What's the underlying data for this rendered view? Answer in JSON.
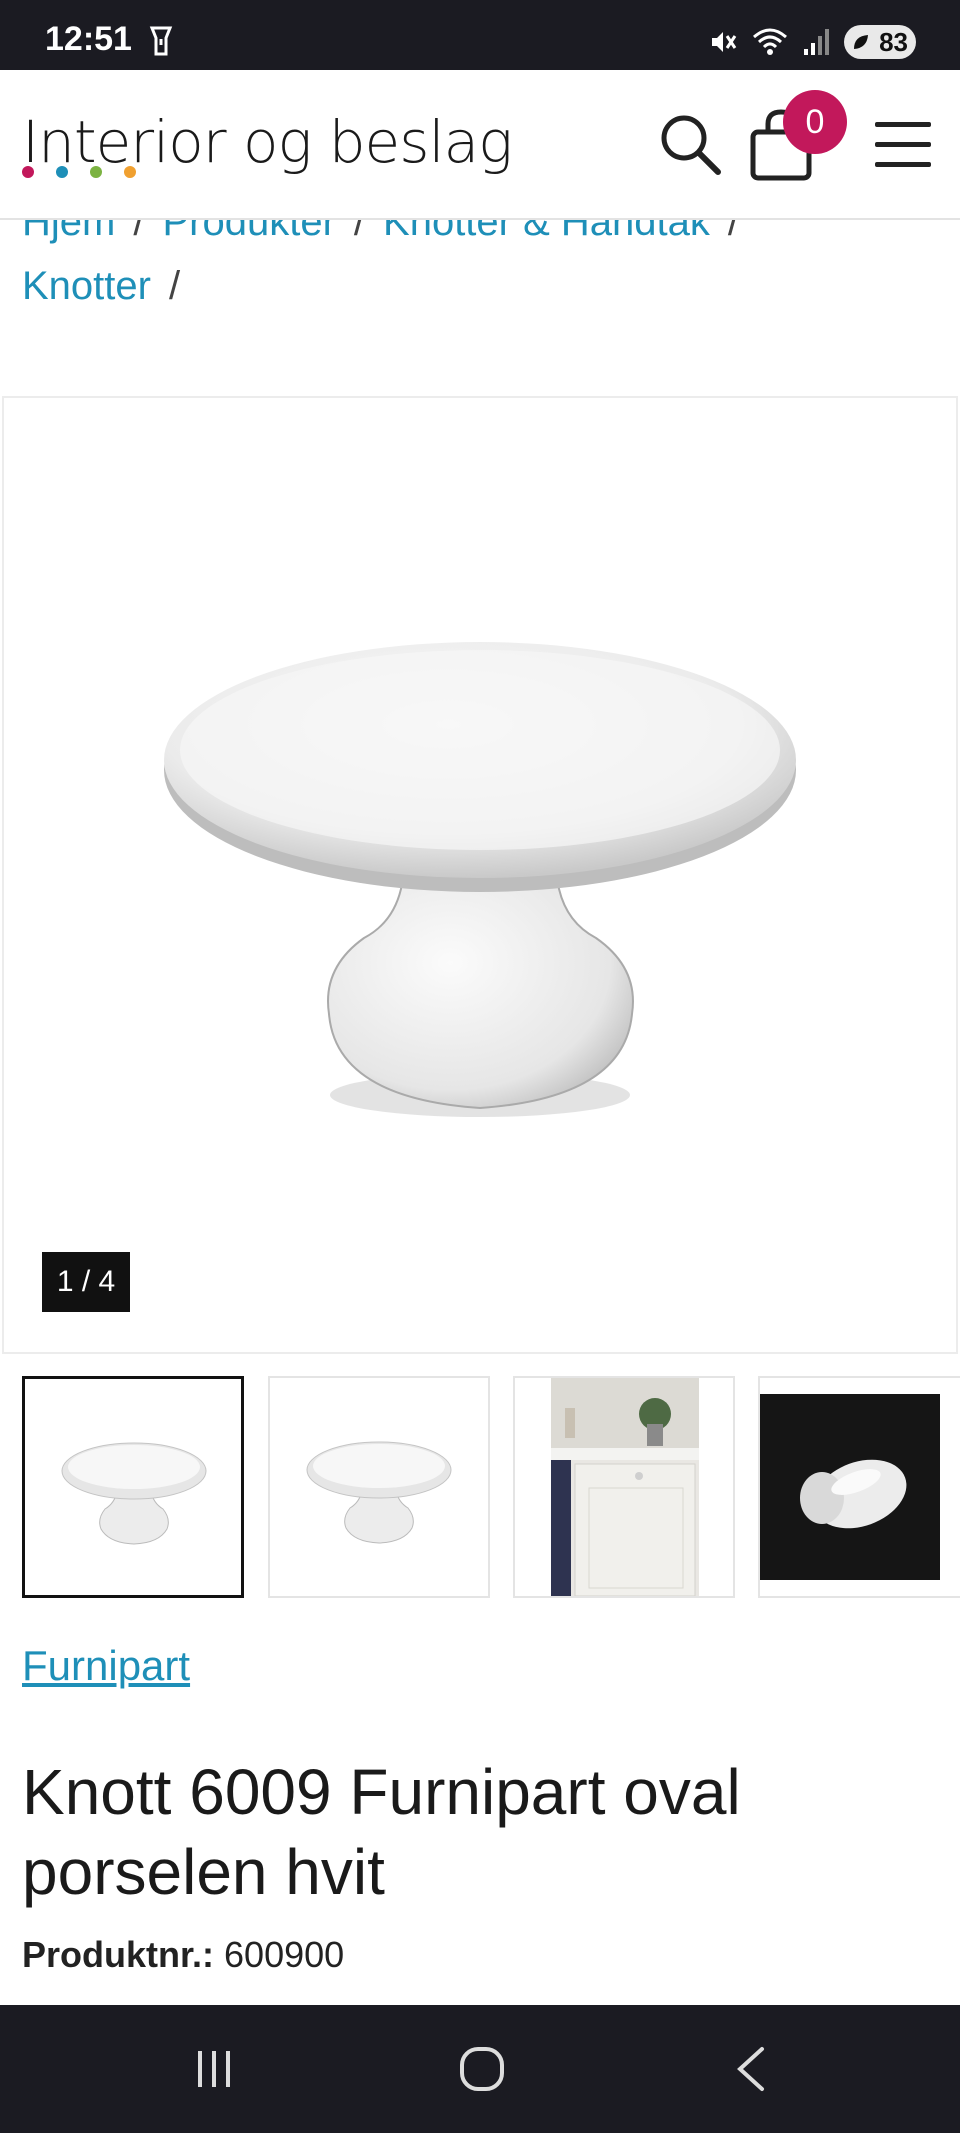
{
  "status_bar": {
    "time": "12:51",
    "battery": "83",
    "icons": [
      "flashlight-icon",
      "mute-icon",
      "wifi-icon",
      "signal-icon",
      "battery-icon"
    ]
  },
  "header": {
    "logo_text": "Interior og beslag",
    "logo_dot_colors": [
      "#c2185b",
      "#1e8fb8",
      "#7cb342",
      "#f0a030"
    ],
    "cart_count": "0",
    "badge_color": "#c2185b"
  },
  "breadcrumb": {
    "items": [
      "Hjem",
      "Produkter",
      "Knotter & Håndtak",
      "Knotter"
    ],
    "separator": "/"
  },
  "gallery": {
    "counter": "1 / 4",
    "thumbnails": [
      "white-knob-front",
      "white-knob-angle",
      "kitchen-cabinet-photo",
      "knob-on-black"
    ]
  },
  "product": {
    "brand": "Furnipart",
    "title": "Knott 6009 Furnipart oval porselen hvit",
    "sku_label": "Produktnr.:",
    "sku_value": "600900"
  },
  "colors": {
    "link": "#1e8fb8",
    "system_bar": "#1b1b22"
  }
}
